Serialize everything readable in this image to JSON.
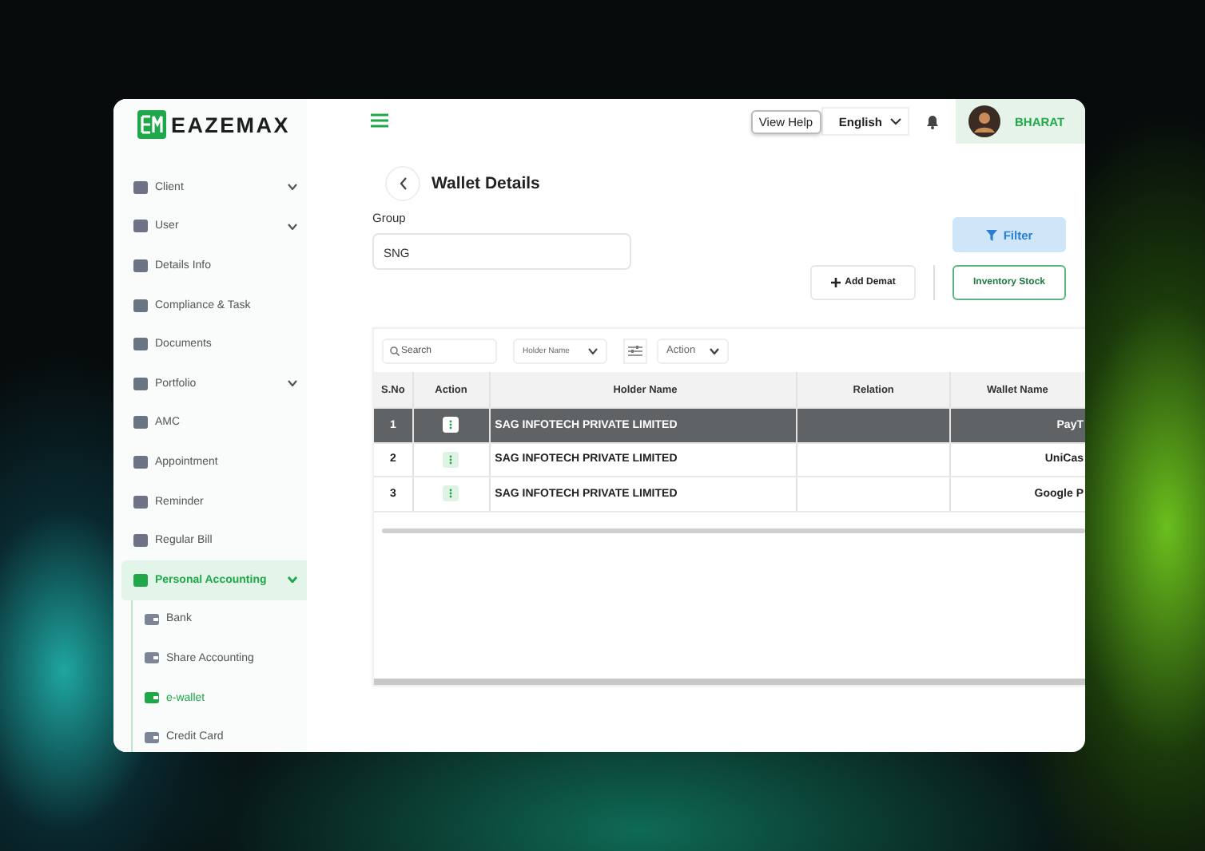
{
  "brand": {
    "name": "EAZEMAX"
  },
  "sidebar": {
    "items": [
      {
        "label": "Client",
        "selected": false,
        "expanded": false
      },
      {
        "label": "User",
        "selected": false,
        "expanded": false
      },
      {
        "label": "Details Info",
        "selected": false
      },
      {
        "label": "Compliance & Task",
        "selected": false
      },
      {
        "label": "Documents",
        "selected": false
      },
      {
        "label": "Portfolio",
        "selected": false,
        "expanded": false
      },
      {
        "label": "AMC",
        "selected": false
      },
      {
        "label": "Appointment",
        "selected": false
      },
      {
        "label": "Reminder",
        "selected": false
      },
      {
        "label": "Regular Bill",
        "selected": false
      },
      {
        "label": "Personal Accounting",
        "selected": true,
        "expanded": true,
        "children": [
          {
            "label": "Bank",
            "selected": false
          },
          {
            "label": "Share Accounting",
            "selected": false
          },
          {
            "label": "e-wallet",
            "selected": true
          },
          {
            "label": "Credit Card",
            "selected": false
          }
        ]
      }
    ]
  },
  "topbar": {
    "tooltip": "View Help",
    "language": "English",
    "user": "BHARAT"
  },
  "page": {
    "title": "Wallet Details",
    "group_label": "Group",
    "group_value": "SNG",
    "filter_button": "Filter",
    "add_button": "Add Demat",
    "inventory_button": "Inventory Stock"
  },
  "toolbar": {
    "search_placeholder": "Search",
    "holder_dropdown": "Holder Name",
    "action_dropdown": "Action"
  },
  "table": {
    "columns": [
      "S.No",
      "Action",
      "Holder Name",
      "Relation",
      "Wallet Name"
    ],
    "rows": [
      {
        "sno": "1",
        "holder": "SAG INFOTECH PRIVATE LIMITED",
        "wallet": "PayT",
        "selected": true
      },
      {
        "sno": "2",
        "holder": "SAG INFOTECH PRIVATE LIMITED",
        "wallet": "UniCas",
        "selected": false
      },
      {
        "sno": "3",
        "holder": "SAG INFOTECH PRIVATE LIMITED",
        "wallet": "Google P",
        "selected": false
      }
    ]
  }
}
